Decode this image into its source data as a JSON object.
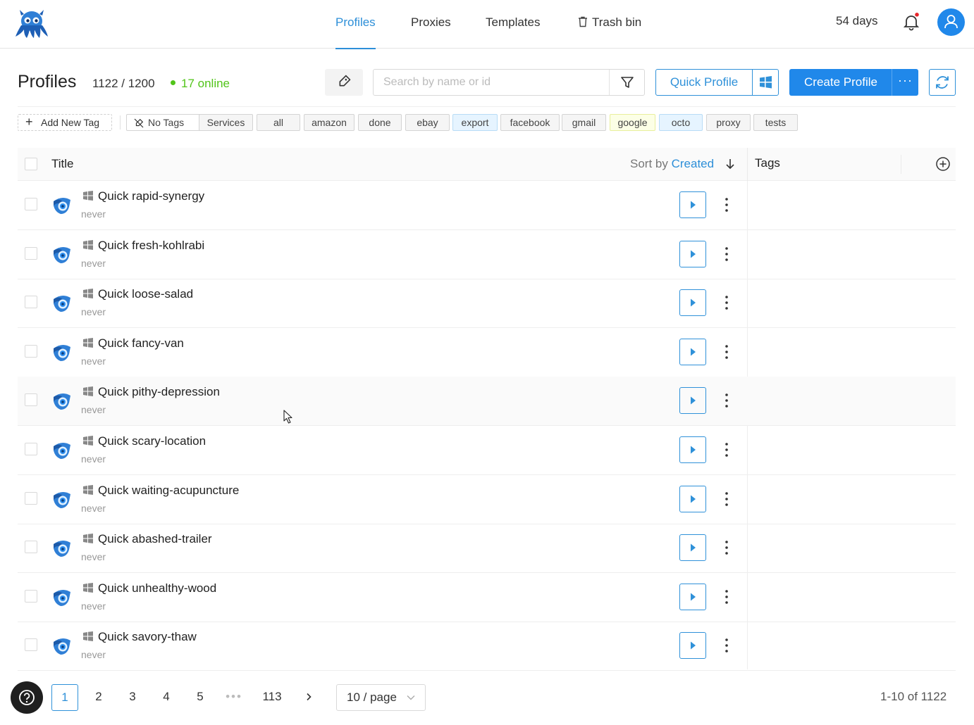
{
  "nav": {
    "items": [
      {
        "label": "Profiles",
        "active": true
      },
      {
        "label": "Proxies",
        "active": false
      },
      {
        "label": "Templates",
        "active": false
      },
      {
        "label": "Trash bin",
        "active": false
      }
    ],
    "days": "54 days"
  },
  "toolbar": {
    "title": "Profiles",
    "count": "1122 / 1200",
    "online": "17 online",
    "search_placeholder": "Search by name or id",
    "quick_profile": "Quick Profile",
    "create_profile": "Create Profile",
    "create_more": "···"
  },
  "tags": {
    "add_label": "Add New Tag",
    "no_tags": "No Tags",
    "items": [
      "Services",
      "all",
      "amazon",
      "done",
      "ebay",
      "export",
      "facebook",
      "gmail",
      "google",
      "octo",
      "proxy",
      "tests"
    ]
  },
  "table": {
    "col_title": "Title",
    "sort_prefix": "Sort by",
    "sort_field": "Created",
    "col_tags": "Tags",
    "rows": [
      {
        "name": "Quick rapid-synergy",
        "sub": "never"
      },
      {
        "name": "Quick fresh-kohlrabi",
        "sub": "never"
      },
      {
        "name": "Quick loose-salad",
        "sub": "never"
      },
      {
        "name": "Quick fancy-van",
        "sub": "never"
      },
      {
        "name": "Quick pithy-depression",
        "sub": "never"
      },
      {
        "name": "Quick scary-location",
        "sub": "never"
      },
      {
        "name": "Quick waiting-acupuncture",
        "sub": "never"
      },
      {
        "name": "Quick abashed-trailer",
        "sub": "never"
      },
      {
        "name": "Quick unhealthy-wood",
        "sub": "never"
      },
      {
        "name": "Quick savory-thaw",
        "sub": "never"
      }
    ]
  },
  "pagination": {
    "pages": [
      "1",
      "2",
      "3",
      "4",
      "5",
      "•••",
      "113"
    ],
    "current": "1",
    "per_page": "10 / page",
    "range": "1-10 of 1122"
  },
  "colors": {
    "accent": "#2d8fd8",
    "primary": "#2088ea",
    "online": "#52c41a"
  }
}
